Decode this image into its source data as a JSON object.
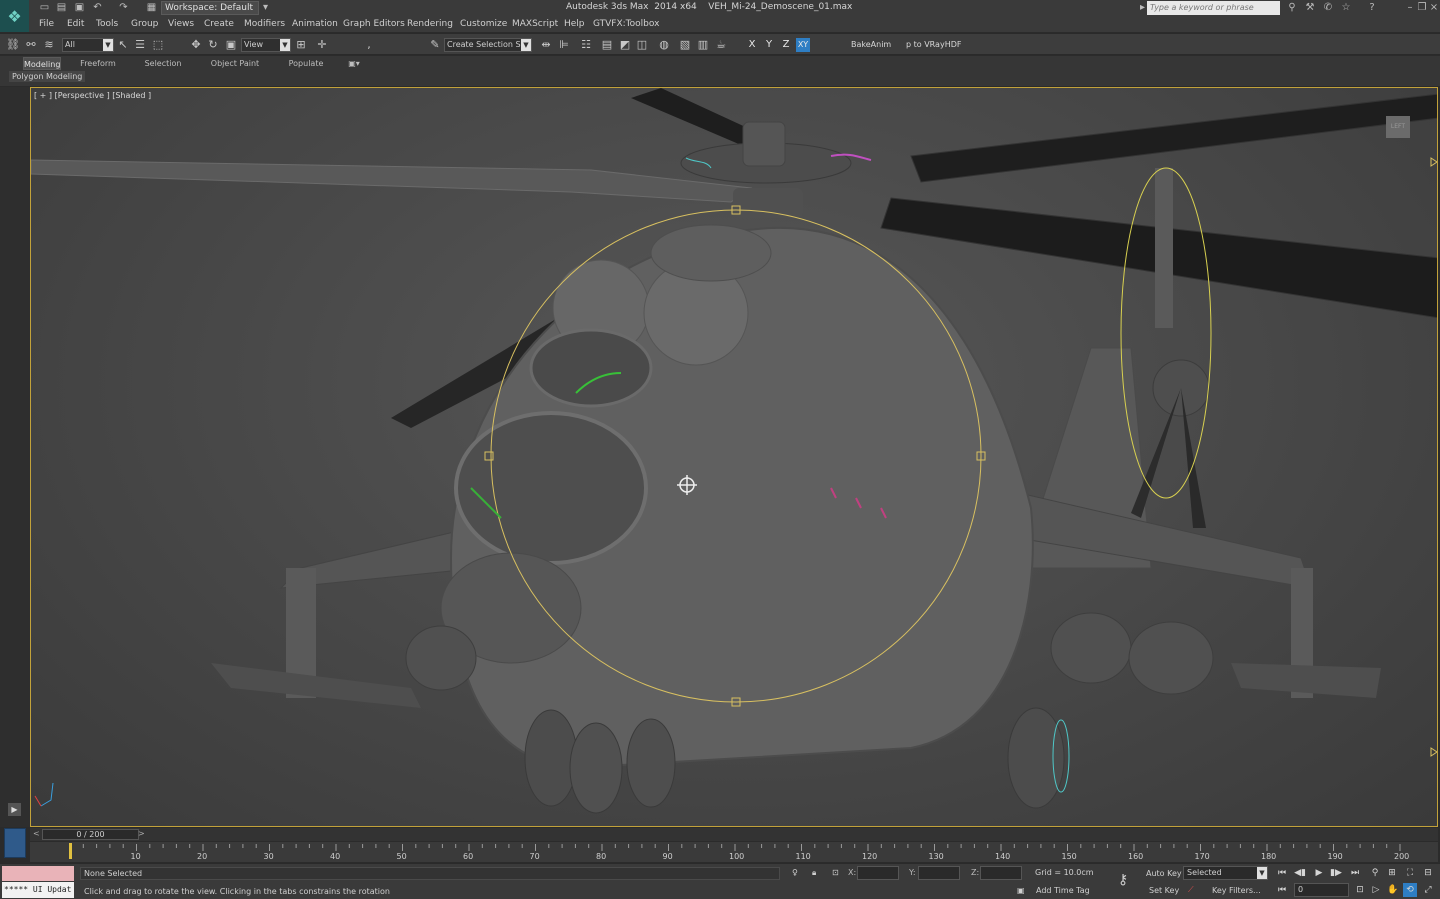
{
  "titlebar": {
    "workspace": "Workspace: Default",
    "title": "Autodesk 3ds Max  2014 x64    VEH_Mi-24_Demoscene_01.max",
    "search_placeholder": "Type a keyword or phrase"
  },
  "menu": [
    "File",
    "Edit",
    "Tools",
    "Group",
    "Views",
    "Create",
    "Modifiers",
    "Animation",
    "Graph Editors",
    "Rendering",
    "Customize",
    "MAXScript",
    "Help",
    "GTVFX:Toolbox"
  ],
  "toolbar": {
    "filter": "All",
    "ref_coord": "View",
    "selection_set_placeholder": "Create Selection Se",
    "axes": [
      "X",
      "Y",
      "Z",
      "XY"
    ],
    "bake_anim": "BakeAnim",
    "vrayhdr": "p to VRayHDF"
  },
  "ribbon": {
    "tabs": [
      "Modeling",
      "Freeform",
      "Selection",
      "Object Paint",
      "Populate"
    ],
    "active_tab": "Modeling",
    "subpanel": "Polygon Modeling"
  },
  "viewport": {
    "label": "[ + ] [Perspective ] [Shaded ]",
    "viewcube_label": "LEFT"
  },
  "timeslider": {
    "position": "0 / 200",
    "current_frame": 0,
    "total_frames": 200,
    "tick_labels": [
      "10",
      "20",
      "30",
      "40",
      "50",
      "60",
      "70",
      "80",
      "90",
      "100",
      "110",
      "120",
      "130",
      "140",
      "150",
      "160",
      "170",
      "180",
      "190",
      "200"
    ]
  },
  "status": {
    "listener": "***** UI Updat",
    "selection": "None Selected",
    "prompt": "Click and drag to rotate the view.  Clicking in the tabs constrains the rotation",
    "x_label": "X:",
    "y_label": "Y:",
    "z_label": "Z:",
    "grid": "Grid = 10.0cm",
    "add_time_tag": "Add Time Tag",
    "auto_key": "Auto Key",
    "set_key": "Set Key",
    "selected": "Selected",
    "key_filters": "Key Filters...",
    "frame": "0"
  },
  "colors": {
    "viewport_border": "#c2a23a",
    "gizmo": "#d8c060",
    "active_axis": "#2e7ec4"
  }
}
